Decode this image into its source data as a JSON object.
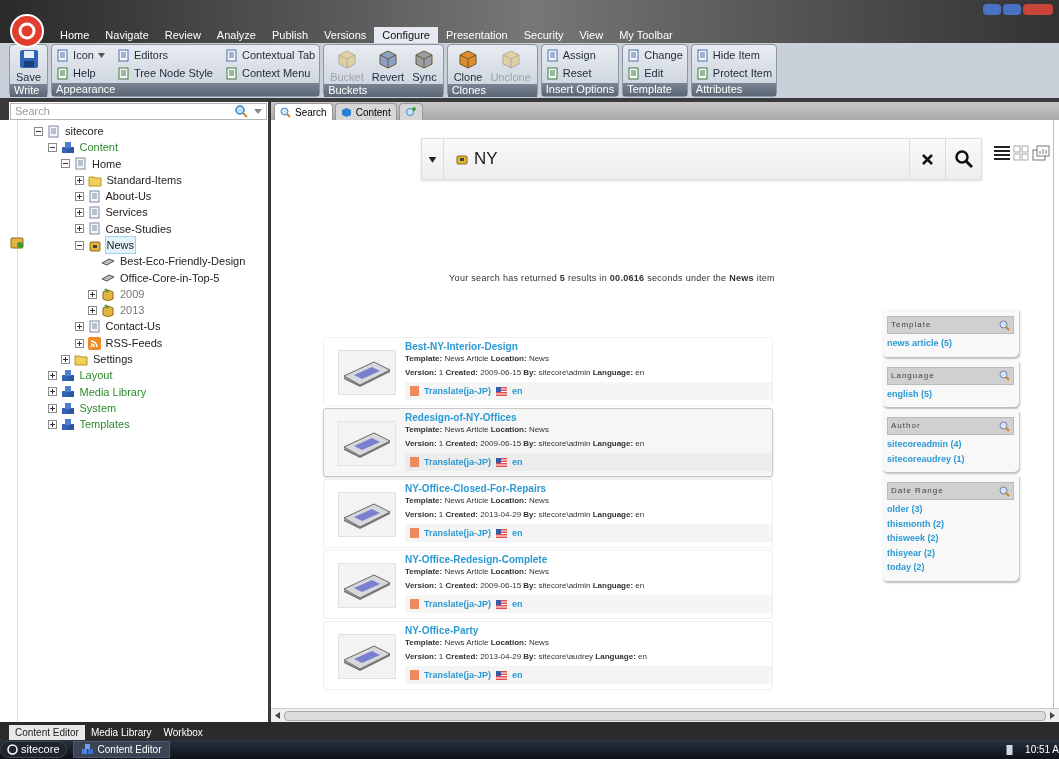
{
  "ribbon": {
    "tabs": [
      {
        "label": "Home",
        "selected": false
      },
      {
        "label": "Navigate",
        "selected": false
      },
      {
        "label": "Review",
        "selected": false
      },
      {
        "label": "Analyze",
        "selected": false
      },
      {
        "label": "Publish",
        "selected": false
      },
      {
        "label": "Versions",
        "selected": false
      },
      {
        "label": "Configure",
        "selected": true
      },
      {
        "label": "Presentation",
        "selected": false
      },
      {
        "label": "Security",
        "selected": false
      },
      {
        "label": "View",
        "selected": false
      },
      {
        "label": "My Toolbar",
        "selected": false
      }
    ],
    "groups": [
      {
        "label": "Write",
        "kind": "large",
        "items": [
          {
            "label": "Save",
            "disabled": false
          }
        ]
      },
      {
        "label": "Appearance",
        "kind": "small",
        "items": [
          {
            "label": "Icon",
            "disabled": false,
            "dropdown": true
          },
          {
            "label": "Help",
            "disabled": false,
            "dropdown": false
          },
          {
            "label": "Editors",
            "disabled": false,
            "dropdown": false
          },
          {
            "label": "Tree Node Style",
            "disabled": false,
            "dropdown": false
          },
          {
            "label": "Contextual Tab",
            "disabled": false,
            "dropdown": false
          },
          {
            "label": "Context Menu",
            "disabled": false,
            "dropdown": false
          }
        ]
      },
      {
        "label": "Buckets",
        "kind": "large",
        "items": [
          {
            "label": "Bucket",
            "disabled": true
          },
          {
            "label": "Revert",
            "disabled": false
          },
          {
            "label": "Sync",
            "disabled": false
          }
        ]
      },
      {
        "label": "Clones",
        "kind": "large",
        "items": [
          {
            "label": "Clone",
            "disabled": false
          },
          {
            "label": "Unclone",
            "disabled": true
          }
        ]
      },
      {
        "label": "Insert Options",
        "kind": "small",
        "items": [
          {
            "label": "Assign",
            "disabled": false,
            "dropdown": false
          },
          {
            "label": "Reset",
            "disabled": false,
            "dropdown": false
          }
        ]
      },
      {
        "label": "Template",
        "kind": "small",
        "items": [
          {
            "label": "Change",
            "disabled": false,
            "dropdown": false
          },
          {
            "label": "Edit",
            "disabled": false,
            "dropdown": false
          }
        ]
      },
      {
        "label": "Attributes",
        "kind": "small",
        "items": [
          {
            "label": "Hide Item",
            "disabled": false,
            "dropdown": false
          },
          {
            "label": "Protect Item",
            "disabled": false,
            "dropdown": false
          }
        ]
      }
    ]
  },
  "tree": {
    "search": {
      "placeholder": "Search"
    },
    "nodes": [
      {
        "label": "sitecore",
        "kind": "page",
        "expanded": true,
        "selected": false,
        "children": [
          {
            "label": "Content",
            "kind": "system",
            "expanded": true,
            "selected": false,
            "children": [
              {
                "label": "Home",
                "kind": "page",
                "expanded": true,
                "selected": false,
                "children": [
                  {
                    "label": "Standard-Items",
                    "kind": "folder",
                    "expanded": false,
                    "selected": false
                  },
                  {
                    "label": "About-Us",
                    "kind": "page",
                    "expanded": false,
                    "selected": false
                  },
                  {
                    "label": "Services",
                    "kind": "page",
                    "expanded": false,
                    "selected": false
                  },
                  {
                    "label": "Case-Studies",
                    "kind": "page",
                    "expanded": false,
                    "selected": false
                  },
                  {
                    "label": "News",
                    "kind": "bucket",
                    "expanded": true,
                    "selected": true,
                    "children": [
                      {
                        "label": "Best-Eco-Friendly-Design",
                        "kind": "article",
                        "selected": false
                      },
                      {
                        "label": "Office-Core-in-Top-5",
                        "kind": "article",
                        "selected": false
                      },
                      {
                        "label": "2009",
                        "kind": "bucket_folder",
                        "expanded": false,
                        "selected": false
                      },
                      {
                        "label": "2013",
                        "kind": "bucket_folder",
                        "expanded": false,
                        "selected": false
                      }
                    ]
                  },
                  {
                    "label": "Contact-Us",
                    "kind": "page",
                    "expanded": false,
                    "selected": false
                  },
                  {
                    "label": "RSS-Feeds",
                    "kind": "feed",
                    "expanded": false,
                    "selected": false
                  }
                ]
              },
              {
                "label": "Settings",
                "kind": "folder",
                "expanded": false,
                "selected": false
              }
            ]
          },
          {
            "label": "Layout",
            "kind": "system",
            "expanded": false,
            "selected": false
          },
          {
            "label": "Media Library",
            "kind": "system",
            "expanded": false,
            "selected": false
          },
          {
            "label": "System",
            "kind": "system",
            "expanded": false,
            "selected": false
          },
          {
            "label": "Templates",
            "kind": "system",
            "expanded": false,
            "selected": false
          }
        ]
      }
    ]
  },
  "editor_tabs": [
    {
      "label": "Search",
      "kind": "search",
      "selected": true
    },
    {
      "label": "Content",
      "kind": "content",
      "selected": false
    },
    {
      "kind": "add",
      "selected": false
    }
  ],
  "search": {
    "value": "NY",
    "summary": "Your search has returned **5** results in **00.0616** seconds under the **News** item"
  },
  "results": [
    {
      "title": "Best-NY-Interior-Design",
      "line_1": "**Template:** News Article **Location:** News",
      "line_2": "**Version:** 1 **Created:** 2009-06-15 **By:** sitecore\\admin **Language:** en",
      "translate": "Translate(ja-JP)",
      "language": "en",
      "selected": false
    },
    {
      "title": "Redesign-of-NY-Offices",
      "line_1": "**Template:** News Article **Location:** News",
      "line_2": "**Version:** 1 **Created:** 2009-06-15 **By:** sitecore\\admin **Language:** en",
      "translate": "Translate(ja-JP)",
      "language": "en",
      "selected": true
    },
    {
      "title": "NY-Office-Closed-For-Repairs",
      "line_1": "**Template:** News Article **Location:** News",
      "line_2": "**Version:** 1 **Created:** 2013-04-29 **By:** sitecore\\admin **Language:** en",
      "translate": "Translate(ja-JP)",
      "language": "en",
      "selected": false
    },
    {
      "title": "NY-Office-Redesign-Complete",
      "line_1": "**Template:** News Article **Location:** News",
      "line_2": "**Version:** 1 **Created:** 2009-06-15 **By:** sitecore\\admin **Language:** en",
      "translate": "Translate(ja-JP)",
      "language": "en",
      "selected": false
    },
    {
      "title": "NY-Office-Party",
      "line_1": "**Template:** News Article **Location:** News",
      "line_2": "**Version:** 1 **Created:** 2013-04-29 **By:** sitecore\\audrey **Language:** en",
      "translate": "Translate(ja-JP)",
      "language": "en",
      "selected": false
    }
  ],
  "facets": [
    {
      "title": "Template",
      "items": [
        "news article (5)"
      ]
    },
    {
      "title": "Language",
      "items": [
        "english (5)"
      ]
    },
    {
      "title": "Author",
      "items": [
        "sitecoreadmin (4)",
        "sitecoreaudrey (1)"
      ]
    },
    {
      "title": "Date Range",
      "items": [
        "older (3)",
        "thismonth (2)",
        "thisweek (2)",
        "thisyear (2)",
        "today (2)"
      ]
    }
  ],
  "bottom_tabs": [
    {
      "label": "Content Editor",
      "selected": true
    },
    {
      "label": "Media Library",
      "selected": false
    },
    {
      "label": "Workbox",
      "selected": false
    }
  ],
  "taskbar": {
    "start": "sitecore",
    "apps": [
      {
        "label": "Content Editor",
        "selected": true
      }
    ],
    "clock": "10:51 A"
  }
}
